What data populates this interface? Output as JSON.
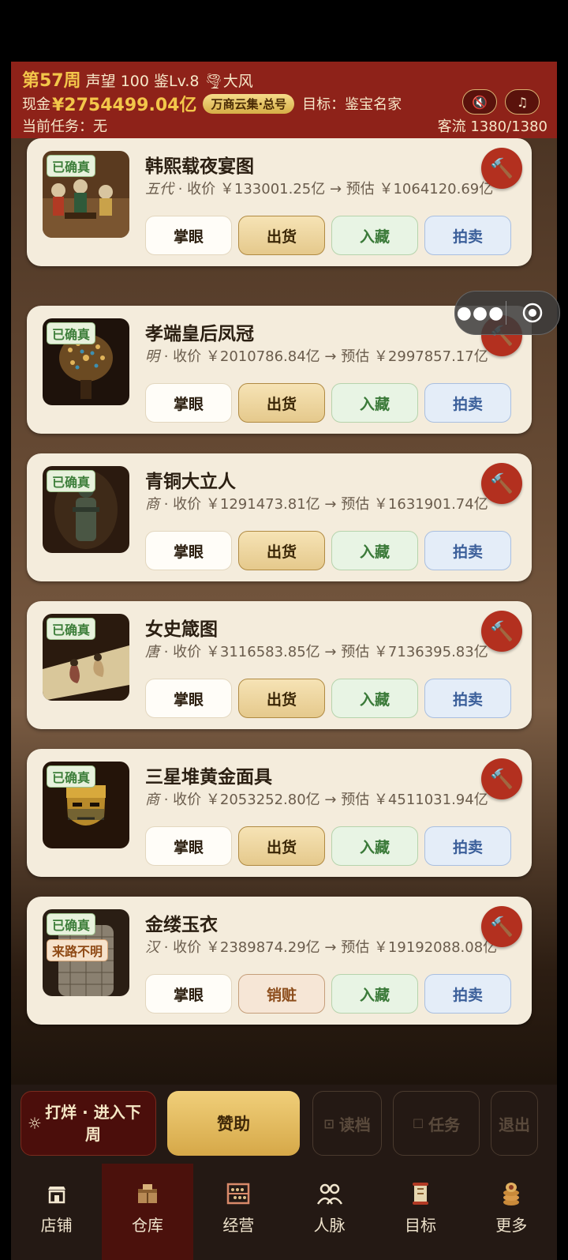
{
  "header": {
    "week": "第57周",
    "reputation": "声望 100",
    "level": "鉴Lv.8",
    "weather_icon": "tornado-icon",
    "weather": "大风",
    "cash_label": "现金",
    "cash": "¥2754499.04亿",
    "tag": "万商云集·总号",
    "target": "目标：鉴宝名家",
    "task": "当前任务：无",
    "traffic": "客流 1380/1380",
    "mute_icon": "speaker-mute-icon",
    "music_icon": "music-note-icon"
  },
  "capsule": {
    "more_icon": "more-dots-icon",
    "close_icon": "target-circle-icon"
  },
  "items": [
    {
      "name": "韩熙载夜宴图",
      "dynasty": "五代",
      "price_text": " · 收价 ￥133001.25亿 → 预估 ￥1064120.69亿",
      "badges": [
        "已确真"
      ],
      "buttons": [
        "掌眼",
        "出货",
        "入藏",
        "拍卖"
      ]
    },
    {
      "name": "孝端皇后凤冠",
      "dynasty": "明",
      "price_text": " · 收价 ￥2010786.84亿 → 预估 ￥2997857.17亿",
      "badges": [
        "已确真"
      ],
      "buttons": [
        "掌眼",
        "出货",
        "入藏",
        "拍卖"
      ]
    },
    {
      "name": "青铜大立人",
      "dynasty": "商",
      "price_text": " · 收价 ￥1291473.81亿 → 预估 ￥1631901.74亿",
      "badges": [
        "已确真"
      ],
      "buttons": [
        "掌眼",
        "出货",
        "入藏",
        "拍卖"
      ]
    },
    {
      "name": "女史箴图",
      "dynasty": "唐",
      "price_text": " · 收价 ￥3116583.85亿 → 预估 ￥7136395.83亿",
      "badges": [
        "已确真"
      ],
      "buttons": [
        "掌眼",
        "出货",
        "入藏",
        "拍卖"
      ]
    },
    {
      "name": "三星堆黄金面具",
      "dynasty": "商",
      "price_text": " · 收价 ￥2053252.80亿 → 预估 ￥4511031.94亿",
      "badges": [
        "已确真"
      ],
      "buttons": [
        "掌眼",
        "出货",
        "入藏",
        "拍卖"
      ]
    },
    {
      "name": "金缕玉衣",
      "dynasty": "汉",
      "price_text": " · 收价 ￥2389874.29亿 → 预估 ￥19192088.08亿",
      "badges": [
        "已确真",
        "来路不明"
      ],
      "buttons": [
        "掌眼",
        "销赃",
        "入藏",
        "拍卖"
      ]
    }
  ],
  "actions": {
    "next_icon": "sun-icon",
    "next_week": "打烊 · 进入下周",
    "sponsor": "赞助",
    "load": "读档",
    "task": "任务",
    "exit": "退出"
  },
  "tabs": [
    {
      "label": "店铺",
      "icon": "shop-icon",
      "active": false
    },
    {
      "label": "仓库",
      "icon": "warehouse-icon",
      "active": true
    },
    {
      "label": "经营",
      "icon": "abacus-icon",
      "active": false
    },
    {
      "label": "人脉",
      "icon": "people-icon",
      "active": false
    },
    {
      "label": "目标",
      "icon": "scroll-icon",
      "active": false
    },
    {
      "label": "更多",
      "icon": "coin-stack-icon",
      "active": false
    }
  ]
}
